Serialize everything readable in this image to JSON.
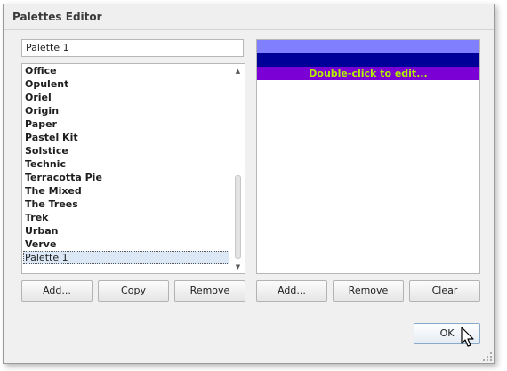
{
  "window": {
    "title": "Palettes Editor"
  },
  "palette_name_input": {
    "value": "Palette 1"
  },
  "palettes_list": {
    "items": [
      "Office",
      "Opulent",
      "Oriel",
      "Origin",
      "Paper",
      "Pastel Kit",
      "Solstice",
      "Technic",
      "Terracotta Pie",
      "The Mixed",
      "The Trees",
      "Trek",
      "Urban",
      "Verve",
      "Palette 1"
    ],
    "selected": "Palette 1"
  },
  "palette_colors": {
    "swatches": [
      {
        "color": "#8080ff",
        "label": ""
      },
      {
        "color": "#000099",
        "label": ""
      },
      {
        "color": "#7b00d6",
        "label": "Double-click to edit...",
        "label_color": "#b4f000"
      }
    ]
  },
  "left_buttons": {
    "add": "Add...",
    "copy": "Copy",
    "remove": "Remove"
  },
  "right_buttons": {
    "add": "Add...",
    "remove": "Remove",
    "clear": "Clear"
  },
  "footer": {
    "ok": "OK"
  },
  "icons": [
    "scroll-up-icon",
    "scroll-down-icon",
    "mouse-cursor-icon",
    "resize-grip-icon"
  ]
}
